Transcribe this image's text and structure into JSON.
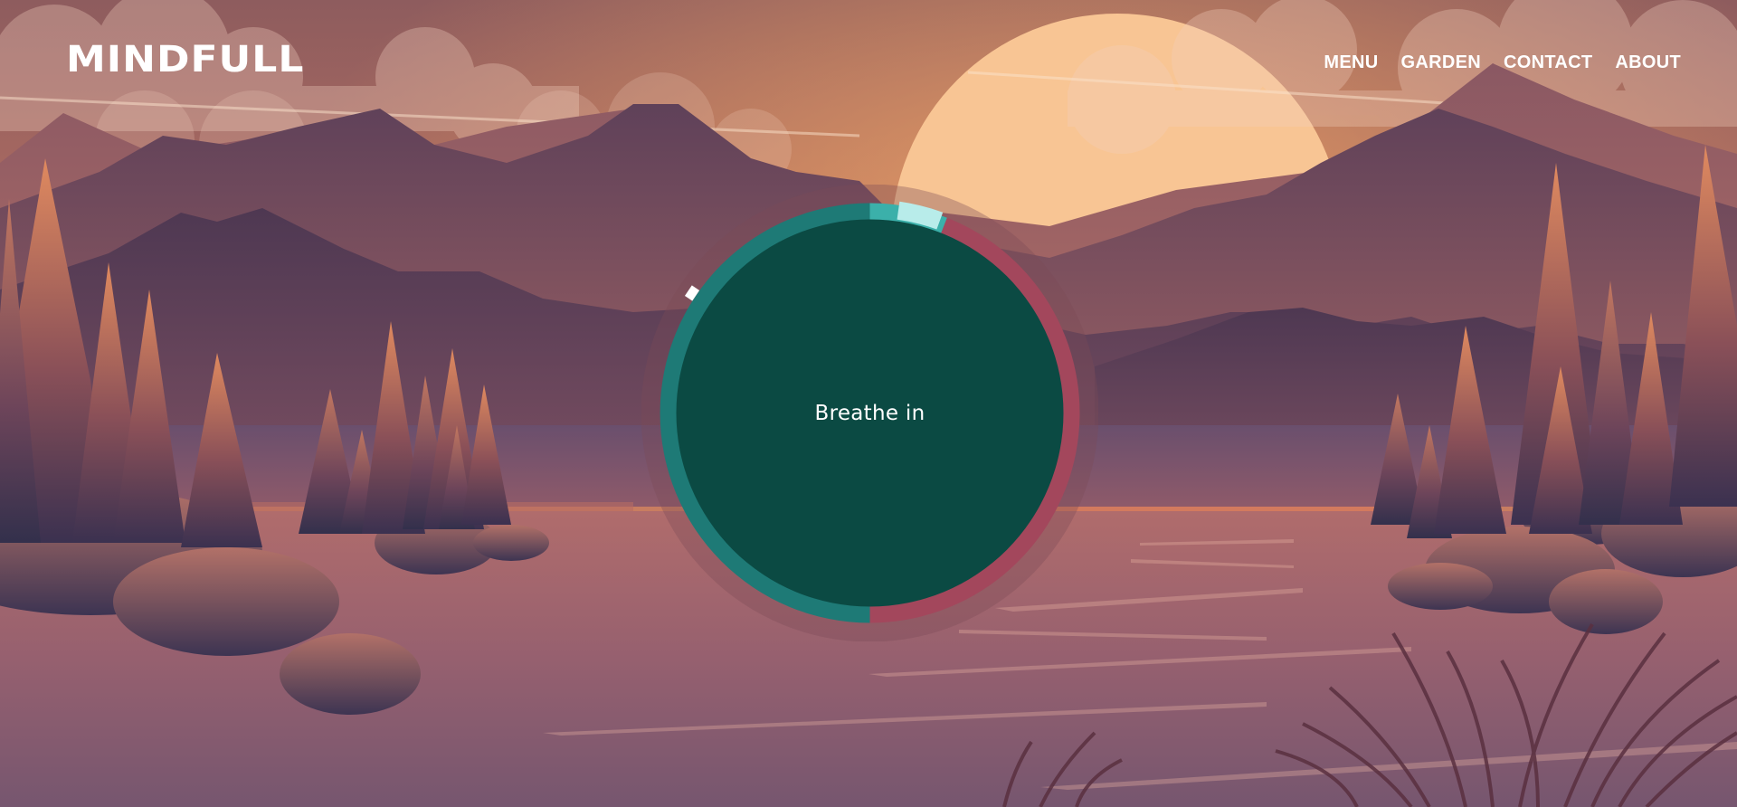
{
  "brand": {
    "logo": "MINDFULL"
  },
  "nav": {
    "items": [
      "MENU",
      "GARDEN",
      "CONTACT",
      "ABOUT"
    ]
  },
  "breathing": {
    "prompt": "Breathe in",
    "progress_fraction": 0.01,
    "phases": [
      {
        "name": "inhale",
        "fraction": 0.5,
        "color": "#1e7a76"
      },
      {
        "name": "hold",
        "fraction": 0.06,
        "color": "#3bb0aa"
      },
      {
        "name": "exhale",
        "fraction": 0.44,
        "color": "#a3475c"
      }
    ],
    "center_color": "#0b4a43",
    "pointer_color": "#ffffff"
  },
  "colors": {
    "sky_top": "#8e5c5e",
    "sky_glow": "#d98d5e",
    "sun": "#f8c594",
    "water": "#9a5f6e",
    "mountain_far": "#a15f62",
    "mountain_mid": "#7e4f5d",
    "mountain_near": "#5a3d56"
  }
}
